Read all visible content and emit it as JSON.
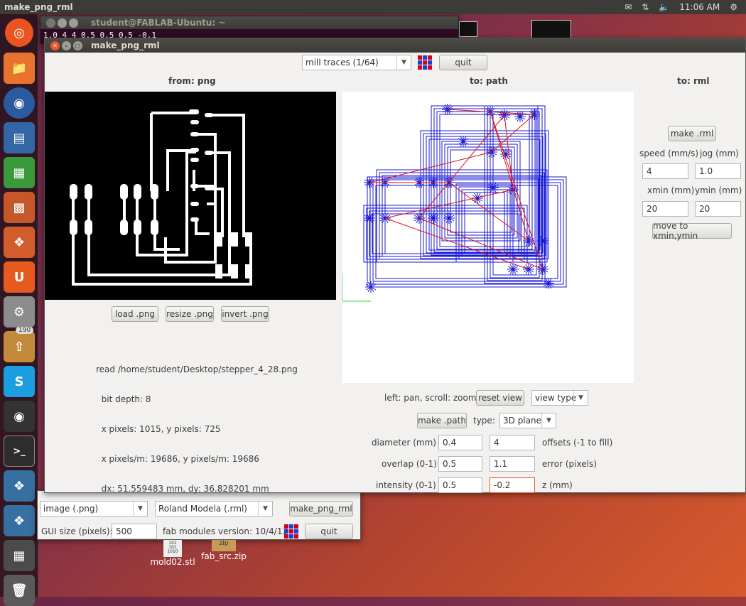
{
  "topbar": {
    "app_title": "make_png_rml",
    "time": "11:06 AM"
  },
  "terminal": {
    "title": "student@FABLAB-Ubuntu: ~",
    "content": "1.0 4 4 0.5 0.5 0.5 -0.1"
  },
  "main_window": {
    "title": "make_png_rml",
    "process_select": "mill traces (1/64)",
    "quit_label": "quit",
    "headers": {
      "from": "from: png",
      "to_path": "to: path",
      "to_rml": "to: rml"
    },
    "png_buttons": {
      "load": "load .png",
      "resize": "resize .png",
      "invert": "invert .png"
    },
    "info_lines": [
      "read /home/student/Desktop/stepper_4_28.png",
      "  bit depth: 8",
      "  x pixels: 1015, y pixels: 725",
      "  x pixels/m: 19686, y pixels/m: 19686",
      "  dx: 51.559483 mm, dy: 36.828201 mm"
    ],
    "view": {
      "hint": "left: pan, scroll: zoom",
      "reset_label": "reset view",
      "view_type": "view type"
    },
    "path": {
      "make_label": "make .path",
      "type_label": "type:",
      "type_value": "3D plane",
      "diameter_label": "diameter (mm)",
      "diameter": "0.4",
      "offsets": "4",
      "offsets_label": "offsets (-1 to fill)",
      "overlap_label": "overlap (0-1)",
      "overlap": "0.5",
      "error": "1.1",
      "error_label": "error (pixels)",
      "intensity_label": "intensity (0-1)",
      "intensity": "0.5",
      "z": "-0.2",
      "z_label": "z (mm)"
    },
    "rml": {
      "make_label": "make .rml",
      "speed_label": "speed (mm/s)",
      "jog_label": "jog (mm)",
      "speed": "4",
      "jog": "1.0",
      "xmin_label": "xmin (mm)",
      "ymin_label": "ymin (mm)",
      "xmin": "20",
      "ymin": "20",
      "move_label": "move to xmin,ymin"
    }
  },
  "launcher_window": {
    "input_format": "image (.png)",
    "output_format": "Roland Modela (.rml)",
    "make_button": "make_png_rml",
    "gui_size_label": "GUI size (pixels):",
    "gui_size": "500",
    "version": "fab modules version: 10/4/13",
    "quit_label": "quit"
  },
  "desktop": {
    "file1": "mold02.stl",
    "file2": "fab_src.zip",
    "file2_tag": "zip",
    "badge_count": "190"
  },
  "colors": {
    "accent": "#e45b27",
    "toolpath": "#1a1ad6",
    "rapid": "#e01010",
    "logo_red": "#d0021b",
    "logo_blue": "#1a3fd6"
  }
}
